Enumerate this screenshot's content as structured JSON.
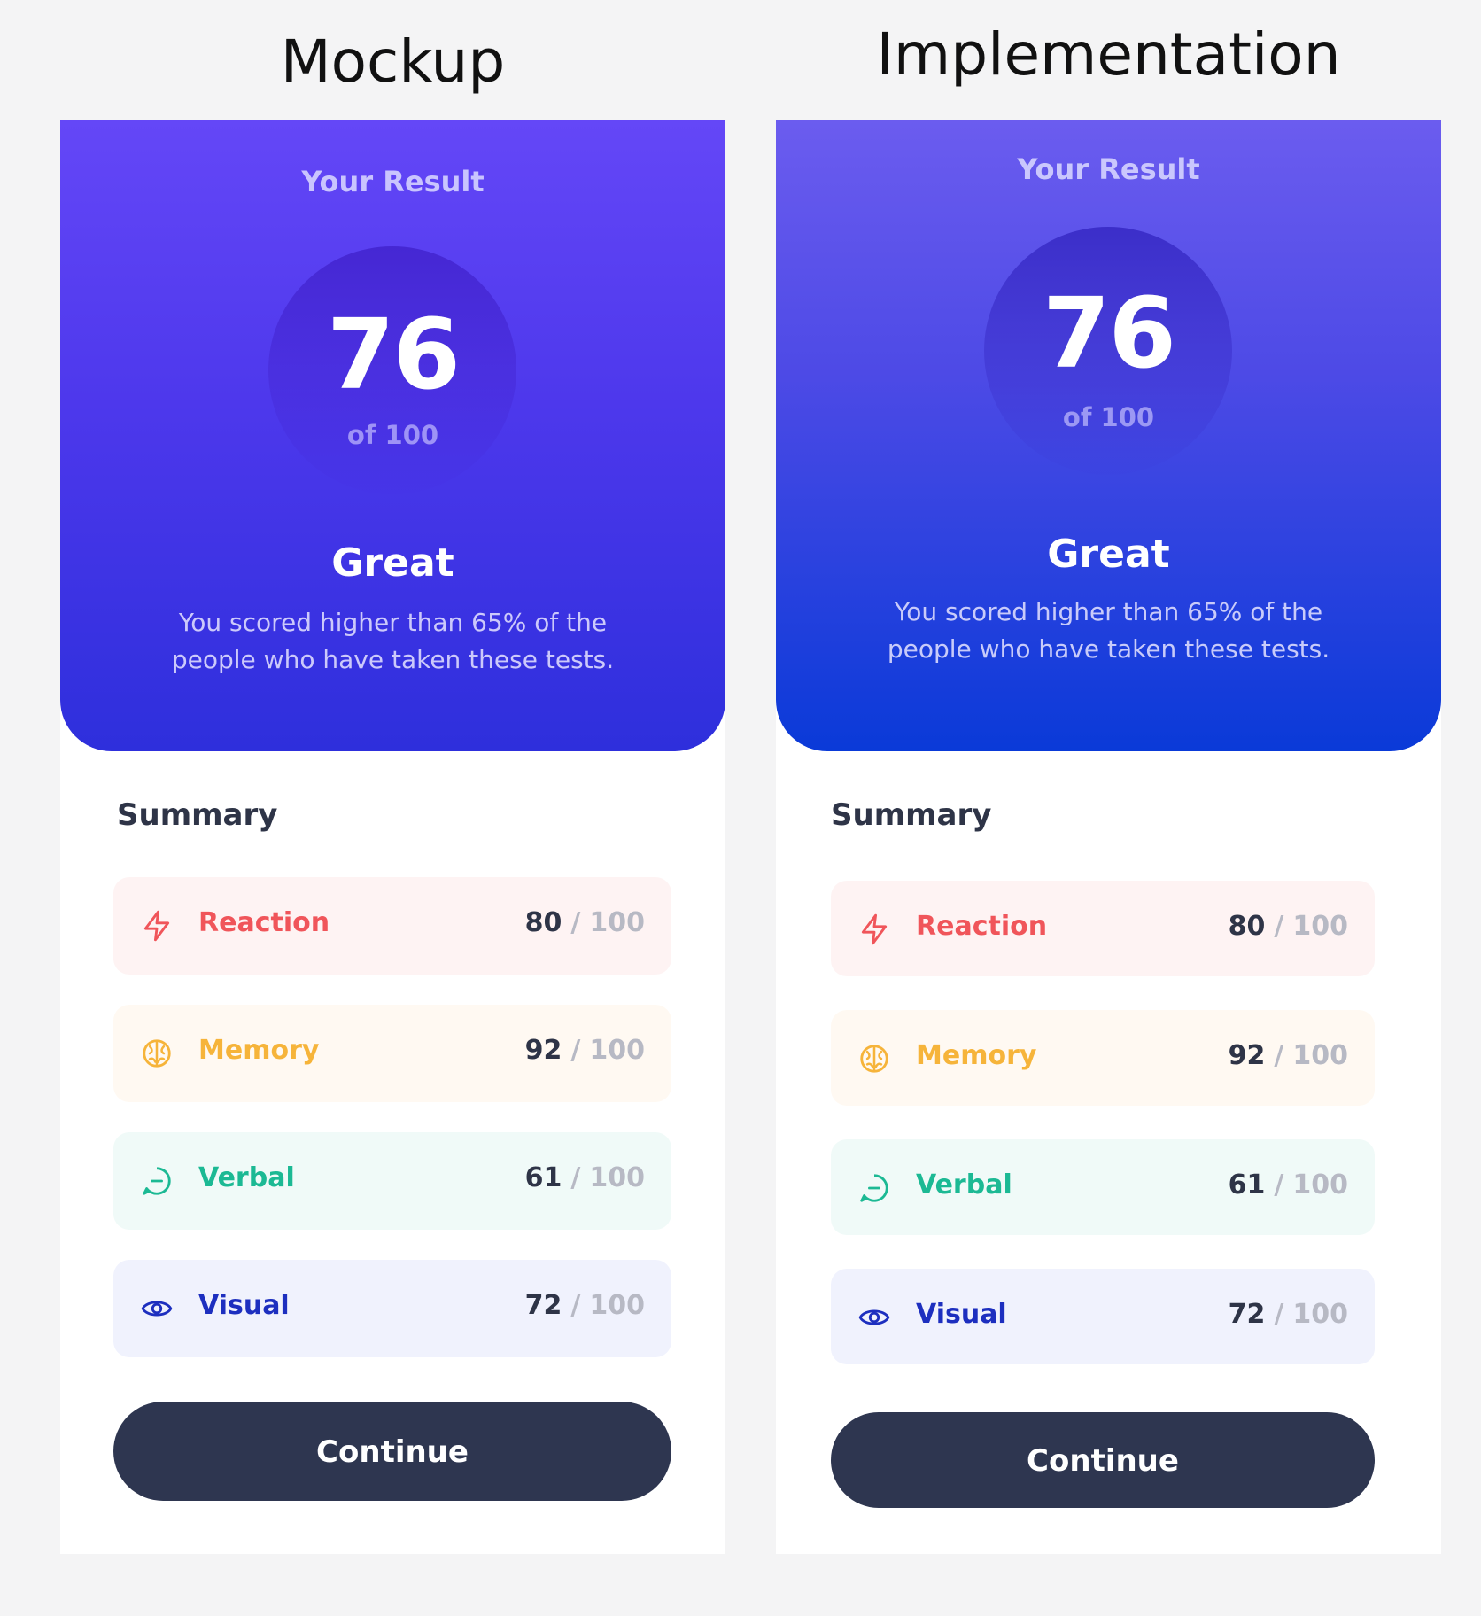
{
  "columns": [
    {
      "heading": "Mockup",
      "hero": {
        "title": "Your Result",
        "score": "76",
        "score_of": "of 100",
        "rating": "Great",
        "description": "You scored higher than 65% of the people who have taken these tests."
      },
      "summary": {
        "title": "Summary",
        "items": [
          {
            "label": "Reaction",
            "value": "80",
            "slash": "/",
            "max": "100",
            "icon": "lightning-icon",
            "color": "#f0555a"
          },
          {
            "label": "Memory",
            "value": "92",
            "slash": "/",
            "max": "100",
            "icon": "brain-icon",
            "color": "#f6b43a"
          },
          {
            "label": "Verbal",
            "value": "61",
            "slash": "/",
            "max": "100",
            "icon": "chat-bubble-icon",
            "color": "#1cb994"
          },
          {
            "label": "Visual",
            "value": "72",
            "slash": "/",
            "max": "100",
            "icon": "eye-icon",
            "color": "#1d2fbf"
          }
        ]
      },
      "button": {
        "label": "Continue"
      }
    },
    {
      "heading": "Implementation",
      "hero": {
        "title": "Your Result",
        "score": "76",
        "score_of": "of 100",
        "rating": "Great",
        "description": "You scored higher than 65% of the people who have taken these tests."
      },
      "summary": {
        "title": "Summary",
        "items": [
          {
            "label": "Reaction",
            "value": "80",
            "slash": "/",
            "max": "100",
            "icon": "lightning-icon",
            "color": "#f0555a"
          },
          {
            "label": "Memory",
            "value": "92",
            "slash": "/",
            "max": "100",
            "icon": "brain-icon",
            "color": "#f6b43a"
          },
          {
            "label": "Verbal",
            "value": "61",
            "slash": "/",
            "max": "100",
            "icon": "chat-bubble-icon",
            "color": "#1cb994"
          },
          {
            "label": "Visual",
            "value": "72",
            "slash": "/",
            "max": "100",
            "icon": "eye-icon",
            "color": "#1d2fbf"
          }
        ]
      },
      "button": {
        "label": "Continue"
      }
    }
  ]
}
